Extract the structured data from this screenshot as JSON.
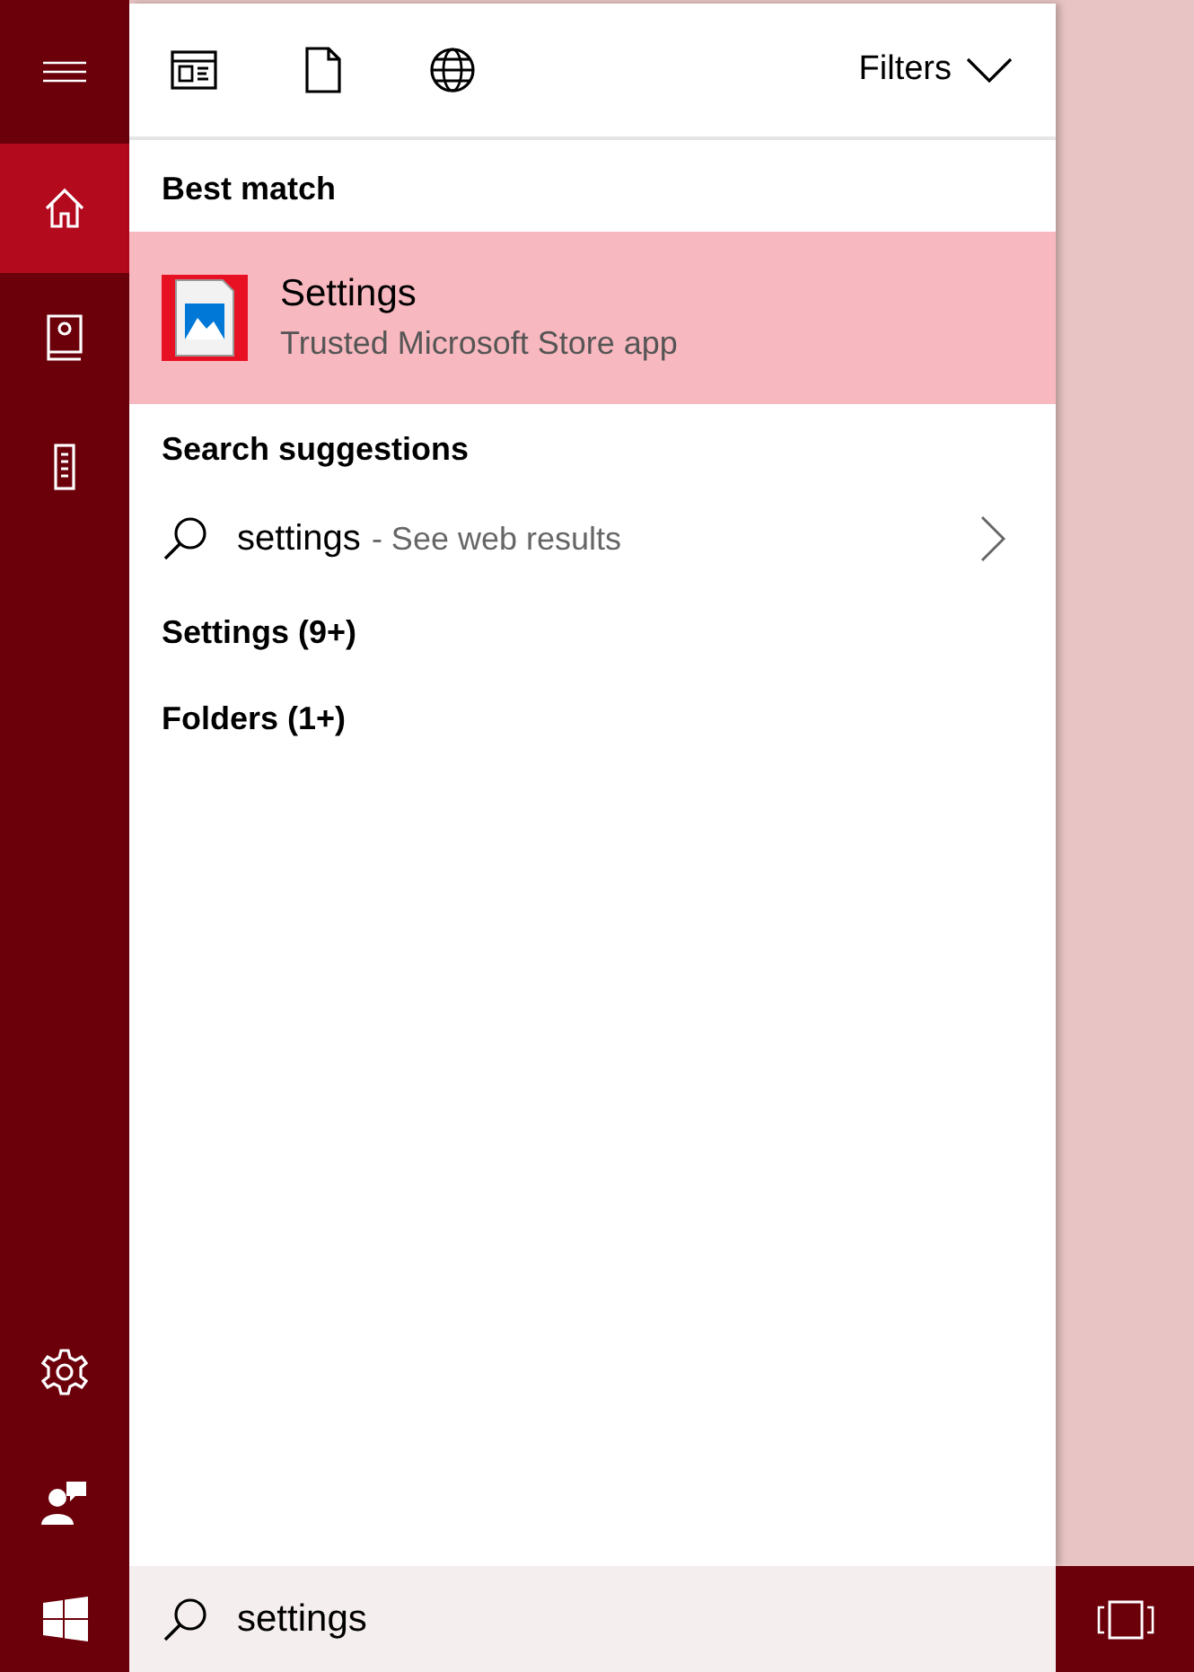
{
  "sidebar": {
    "top_items": [
      {
        "kind": "menu",
        "selected": false
      },
      {
        "kind": "home",
        "selected": true
      },
      {
        "kind": "notebook",
        "selected": false
      },
      {
        "kind": "device",
        "selected": false
      }
    ],
    "bottom_items": [
      {
        "kind": "settings",
        "selected": false
      },
      {
        "kind": "feedback",
        "selected": false
      },
      {
        "kind": "start",
        "selected": false
      }
    ]
  },
  "toolbar": {
    "filter_icons": [
      {
        "kind": "apps"
      },
      {
        "kind": "documents"
      },
      {
        "kind": "web"
      }
    ],
    "filters_label": "Filters"
  },
  "best_match": {
    "heading": "Best match",
    "result": {
      "title": "Settings",
      "subtitle": "Trusted Microsoft Store app",
      "selected": true
    }
  },
  "search_suggestions": {
    "heading": "Search suggestions",
    "items": [
      {
        "query": "settings",
        "hint": "- See web results"
      }
    ]
  },
  "categories": [
    "Settings (9+)",
    "Folders (1+)"
  ],
  "search": {
    "value": "settings"
  }
}
